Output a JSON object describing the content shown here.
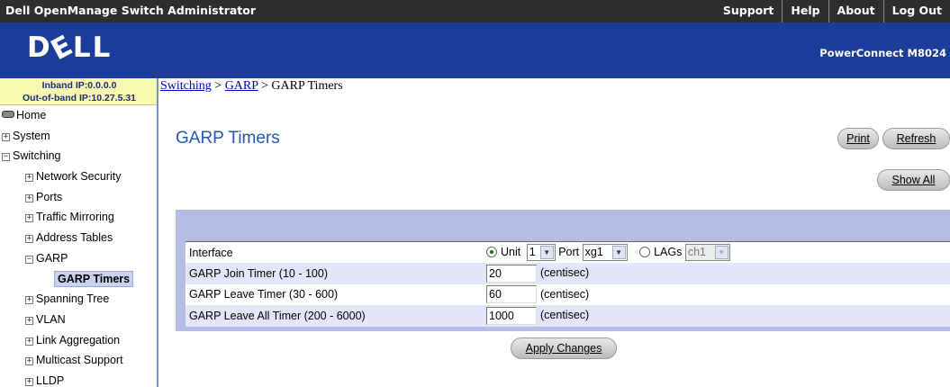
{
  "topbar": {
    "app_title": "Dell OpenManage Switch Administrator",
    "links": [
      "Support",
      "Help",
      "About",
      "Log Out"
    ]
  },
  "banner": {
    "logo": "DELL",
    "product": "PowerConnect M8024"
  },
  "sidebar": {
    "inband_ip": "Inband IP:0.0.0.0",
    "oob_ip": "Out-of-band IP:10.27.5.31",
    "tree": {
      "home": "Home",
      "system": "System",
      "switching": "Switching",
      "network_security": "Network Security",
      "ports": "Ports",
      "traffic_mirroring": "Traffic Mirroring",
      "address_tables": "Address Tables",
      "garp": "GARP",
      "garp_timers": "GARP Timers",
      "spanning_tree": "Spanning Tree",
      "vlan": "VLAN",
      "link_aggregation": "Link Aggregation",
      "multicast_support": "Multicast Support",
      "lldp": "LLDP"
    }
  },
  "breadcrumb": {
    "switching": "Switching",
    "sep1": " > ",
    "garp": "GARP",
    "sep2": " > ",
    "current": "GARP Timers"
  },
  "page": {
    "title": "GARP Timers",
    "print_label": "Print",
    "refresh_label": "Refresh",
    "show_all_label": "Show All",
    "apply_label": "Apply Changes"
  },
  "form": {
    "interface_label": "Interface",
    "unit_label": "Unit",
    "unit_value": "1",
    "port_label": "Port",
    "port_value": "xg1",
    "lags_label": "LAGs",
    "lags_value": "ch1",
    "join_label": "GARP Join Timer (10 - 100)",
    "join_value": "20",
    "leave_label": "GARP Leave Timer (30 - 600)",
    "leave_value": "60",
    "leave_all_label": "GARP Leave All Timer (200 - 6000)",
    "leave_all_value": "1000",
    "unit_suffix": "(centisec)"
  }
}
